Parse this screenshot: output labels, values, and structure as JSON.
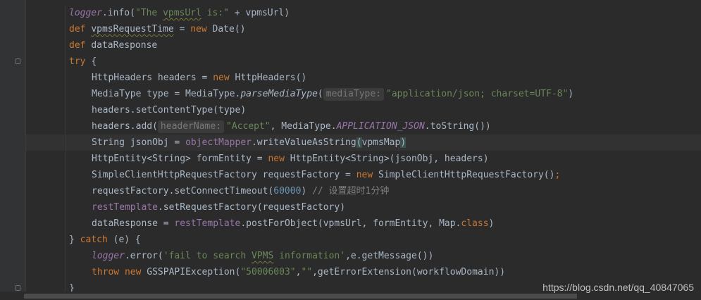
{
  "editor": {
    "lines": [
      {
        "segments": [
          {
            "text": "logger",
            "cls": "fld italic"
          },
          {
            "text": ".info(",
            "cls": ""
          },
          {
            "text": "\"The ",
            "cls": "str"
          },
          {
            "text": "vpmsUrl",
            "cls": "str squig"
          },
          {
            "text": " is:\"",
            "cls": "str"
          },
          {
            "text": " + vpmsUrl)",
            "cls": ""
          }
        ]
      },
      {
        "segments": [
          {
            "text": "def ",
            "cls": "kw"
          },
          {
            "text": "vpmsRequestTime",
            "cls": "squig"
          },
          {
            "text": " = ",
            "cls": ""
          },
          {
            "text": "new ",
            "cls": "kw"
          },
          {
            "text": "Date()",
            "cls": ""
          }
        ]
      },
      {
        "segments": [
          {
            "text": "def ",
            "cls": "kw"
          },
          {
            "text": "dataResponse",
            "cls": ""
          }
        ]
      },
      {
        "segments": [
          {
            "text": "try ",
            "cls": "kw"
          },
          {
            "text": "{",
            "cls": ""
          }
        ]
      },
      {
        "segments": [
          {
            "text": "HttpHeaders headers = ",
            "cls": ""
          },
          {
            "text": "new ",
            "cls": "kw"
          },
          {
            "text": "HttpHeaders()",
            "cls": ""
          }
        ]
      },
      {
        "segments": [
          {
            "text": "MediaType type = MediaType.",
            "cls": ""
          },
          {
            "text": "parseMediaType",
            "cls": "italic"
          },
          {
            "text": "(",
            "cls": ""
          },
          {
            "text": "mediaType:",
            "cls": "hint"
          },
          {
            "text": "\"application/json; charset=UTF-8\"",
            "cls": "str"
          },
          {
            "text": ")",
            "cls": ""
          }
        ]
      },
      {
        "segments": [
          {
            "text": "headers.setContentType(type)",
            "cls": ""
          }
        ]
      },
      {
        "segments": [
          {
            "text": "headers.add(",
            "cls": ""
          },
          {
            "text": "headerName:",
            "cls": "hint"
          },
          {
            "text": "\"Accept\"",
            "cls": "str"
          },
          {
            "text": ", MediaType.",
            "cls": ""
          },
          {
            "text": "APPLICATION_JSON",
            "cls": "fld italic"
          },
          {
            "text": ".toString())",
            "cls": ""
          }
        ]
      },
      {
        "segments": [
          {
            "text": "String jsonObj = ",
            "cls": ""
          },
          {
            "text": "objectMapper",
            "cls": "fld"
          },
          {
            "text": ".writeValueAsString",
            "cls": ""
          },
          {
            "text": "(",
            "cls": "match"
          },
          {
            "text": "vpmsMap",
            "cls": ""
          },
          {
            "text": ")",
            "cls": "match"
          }
        ]
      },
      {
        "segments": [
          {
            "text": "HttpEntity<String> formEntity = ",
            "cls": ""
          },
          {
            "text": "new ",
            "cls": "kw"
          },
          {
            "text": "HttpEntity<String>(jsonObj, headers)",
            "cls": ""
          }
        ]
      },
      {
        "segments": [
          {
            "text": "SimpleClientHttpRequestFactory requestFactory = ",
            "cls": ""
          },
          {
            "text": "new ",
            "cls": "kw"
          },
          {
            "text": "SimpleClientHttpRequestFactory()",
            "cls": ""
          },
          {
            "text": ";",
            "cls": "kw"
          }
        ]
      },
      {
        "segments": [
          {
            "text": "requestFactory.setConnectTimeout(",
            "cls": ""
          },
          {
            "text": "60000",
            "cls": "num"
          },
          {
            "text": ") ",
            "cls": ""
          },
          {
            "text": "// 设置超时1分钟",
            "cls": "cmt"
          }
        ]
      },
      {
        "segments": [
          {
            "text": "restTemplate",
            "cls": "fld"
          },
          {
            "text": ".setRequestFactory(requestFactory)",
            "cls": ""
          }
        ]
      },
      {
        "segments": [
          {
            "text": "dataResponse = ",
            "cls": ""
          },
          {
            "text": "restTemplate",
            "cls": "fld"
          },
          {
            "text": ".postForObject(vpmsUrl, formEntity, Map.",
            "cls": ""
          },
          {
            "text": "class",
            "cls": "kw"
          },
          {
            "text": ")",
            "cls": ""
          }
        ]
      },
      {
        "segments": [
          {
            "text": "} ",
            "cls": ""
          },
          {
            "text": "catch ",
            "cls": "kw"
          },
          {
            "text": "(e) {",
            "cls": ""
          }
        ]
      },
      {
        "segments": [
          {
            "text": "logger",
            "cls": "fld italic"
          },
          {
            "text": ".error(",
            "cls": ""
          },
          {
            "text": "'fail to search ",
            "cls": "str"
          },
          {
            "text": "VPMS",
            "cls": "str squig"
          },
          {
            "text": " information'",
            "cls": "str"
          },
          {
            "text": ",e.getMessage())",
            "cls": ""
          }
        ]
      },
      {
        "segments": [
          {
            "text": "throw new ",
            "cls": "kw"
          },
          {
            "text": "GSSPAPIException(",
            "cls": ""
          },
          {
            "text": "\"50006003\"",
            "cls": "str"
          },
          {
            "text": ",",
            "cls": ""
          },
          {
            "text": "\"\"",
            "cls": "str"
          },
          {
            "text": ",getErrorExtension(workflowDomain))",
            "cls": ""
          }
        ]
      },
      {
        "segments": [
          {
            "text": "}",
            "cls": ""
          }
        ]
      }
    ],
    "current_line": 8
  },
  "watermark": "https://blog.csdn.net/qq_40847065",
  "colors": {
    "background": "#2b2b2b",
    "gutter": "#313335",
    "keyword": "#cc7832",
    "string": "#6a8759",
    "number": "#6897bb",
    "field": "#9876aa",
    "comment": "#808080",
    "default_text": "#a9b7c6"
  }
}
